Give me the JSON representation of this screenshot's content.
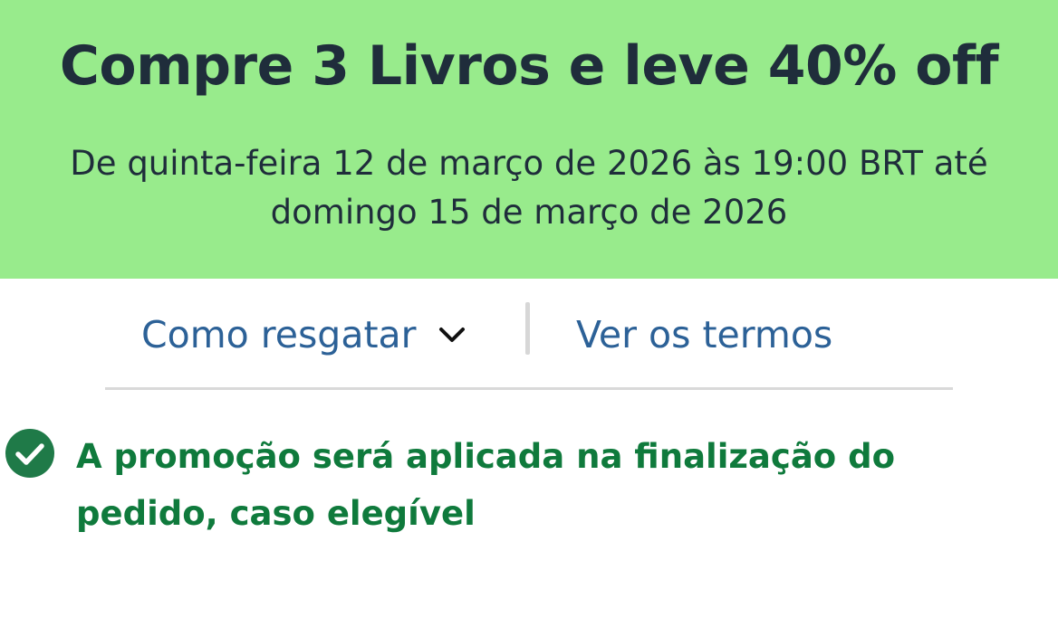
{
  "promo": {
    "title": "Compre 3 Livros e leve 40% off",
    "dates": "De quinta-feira 12 de março de 2026 às 19:00 BRT até domingo 15 de março de 2026",
    "background_color": "#98eb8c"
  },
  "actions": {
    "redeem_label": "Como resgatar",
    "redeem_icon": "chevron-down-icon",
    "terms_label": "Ver os termos",
    "link_color": "#2c6197"
  },
  "notice": {
    "icon": "check-circle-icon",
    "text": "A promoção será aplicada na finalização do pedido, caso elegível",
    "color": "#0f7a3c"
  }
}
